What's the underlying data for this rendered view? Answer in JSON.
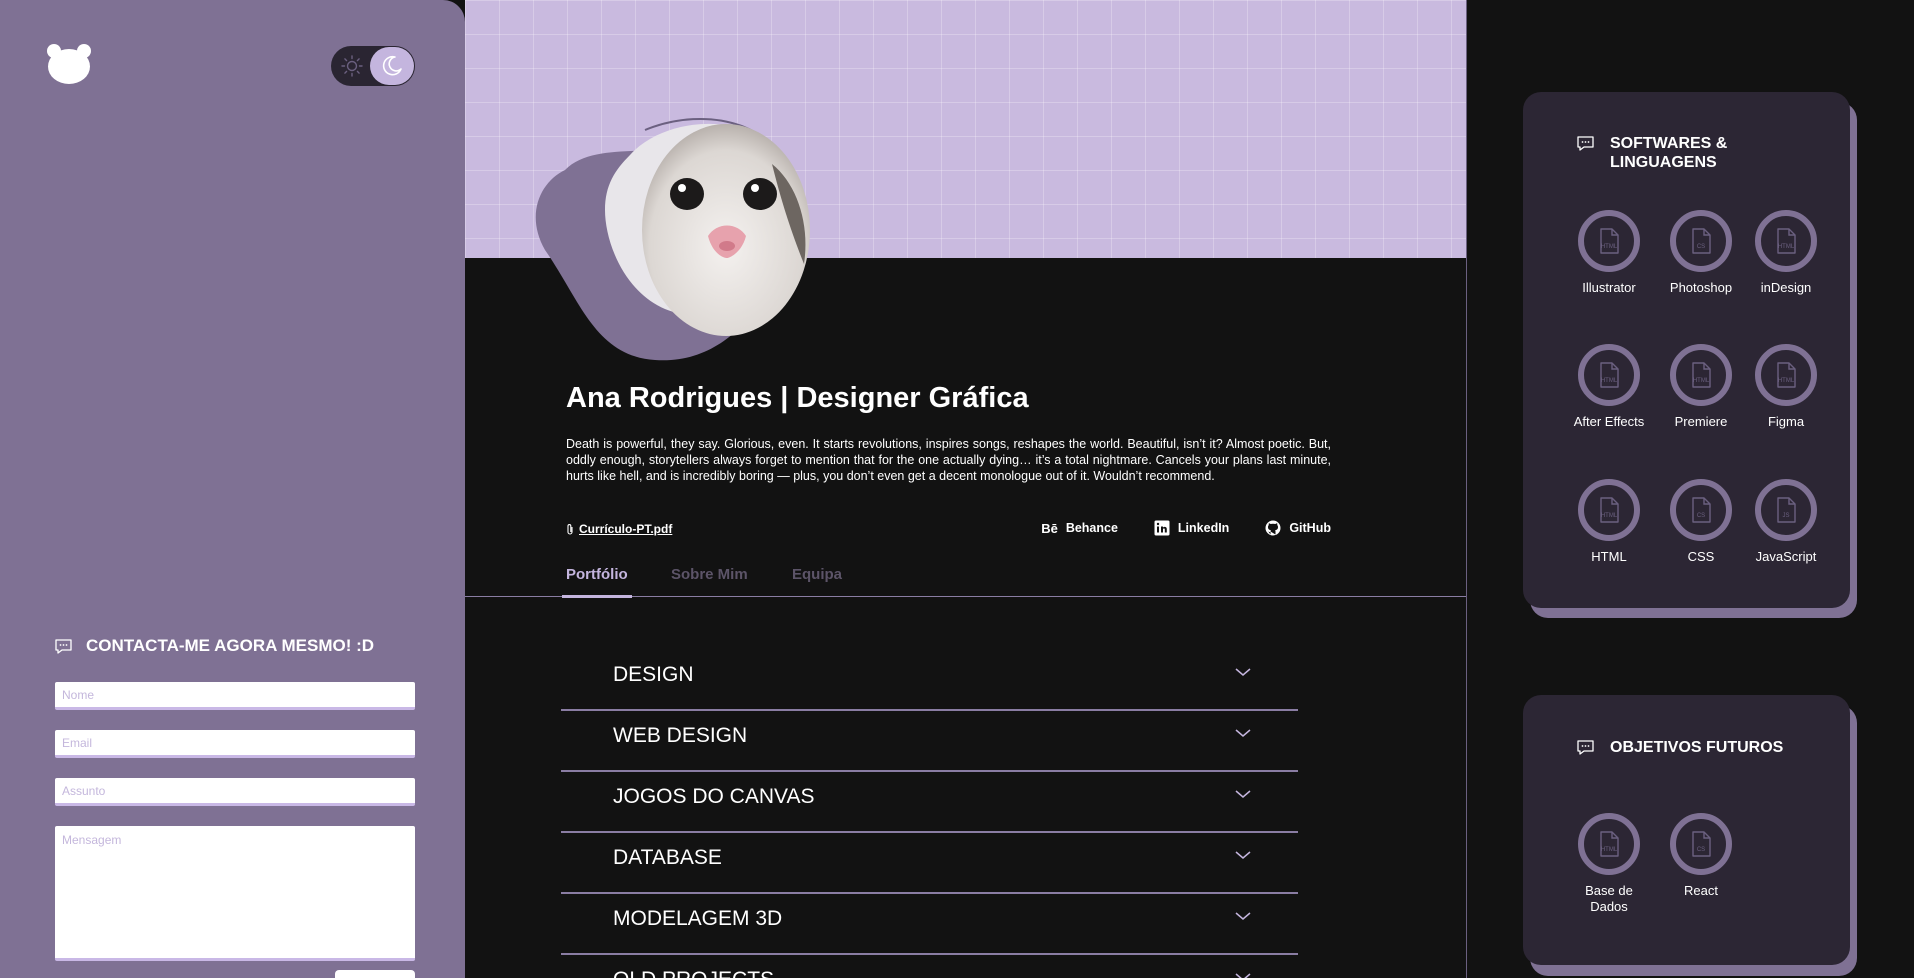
{
  "sidebar": {
    "contact": {
      "title": "CONTACTA-ME AGORA MESMO! :D",
      "name_placeholder": "Nome",
      "email_placeholder": "Email",
      "subject_placeholder": "Assunto",
      "message_placeholder": "Mensagem"
    }
  },
  "profile": {
    "title": "Ana Rodrigues | Designer Gráfica",
    "bio": "Death is powerful, they say. Glorious, even. It starts revolutions, inspires songs, reshapes the world. Beautiful, isn’t it? Almost poetic. But, oddly enough, storytellers always forget to mention that for the one actually dying… it’s a total nightmare. Cancels your plans last minute, hurts like hell, and is incredibly boring — plus, you don’t even get a decent monologue out of it. Wouldn’t recommend.",
    "cv_label": "Currículo-PT.pdf",
    "socials": [
      {
        "label": "Behance",
        "icon": "behance-icon"
      },
      {
        "label": "LinkedIn",
        "icon": "linkedin-icon"
      },
      {
        "label": "GitHub",
        "icon": "github-icon"
      }
    ]
  },
  "tabs": [
    "Portfólio",
    "Sobre Mim",
    "Equipa"
  ],
  "active_tab": "Portfólio",
  "accordion": [
    "DESIGN",
    "WEB DESIGN",
    "JOGOS DO CANVAS",
    "DATABASE",
    "MODELAGEM 3D",
    "OLD PROJECTS"
  ],
  "skills_panel": {
    "title_line1": "SOFTWARES &",
    "title_line2": "LINGUAGENS",
    "items": [
      {
        "name": "Illustrator",
        "tag": "HTML"
      },
      {
        "name": "Photoshop",
        "tag": "CS"
      },
      {
        "name": "inDesign",
        "tag": "HTML"
      },
      {
        "name": "After Effects",
        "tag": "HTML"
      },
      {
        "name": "Premiere",
        "tag": "HTML"
      },
      {
        "name": "Figma",
        "tag": "HTML"
      },
      {
        "name": "HTML",
        "tag": "HTML"
      },
      {
        "name": "CSS",
        "tag": "CS"
      },
      {
        "name": "JavaScript",
        "tag": "JS"
      }
    ]
  },
  "goals_panel": {
    "title": "OBJETIVOS FUTUROS",
    "items": [
      {
        "name_line1": "Base de",
        "name_line2": "Dados",
        "tag": "HTML"
      },
      {
        "name_line1": "React",
        "name_line2": "",
        "tag": "CS"
      }
    ]
  },
  "colors": {
    "sidebar": "#7f7194",
    "accent": "#c4b5de",
    "panel": "#2c2634",
    "background": "#121212"
  }
}
